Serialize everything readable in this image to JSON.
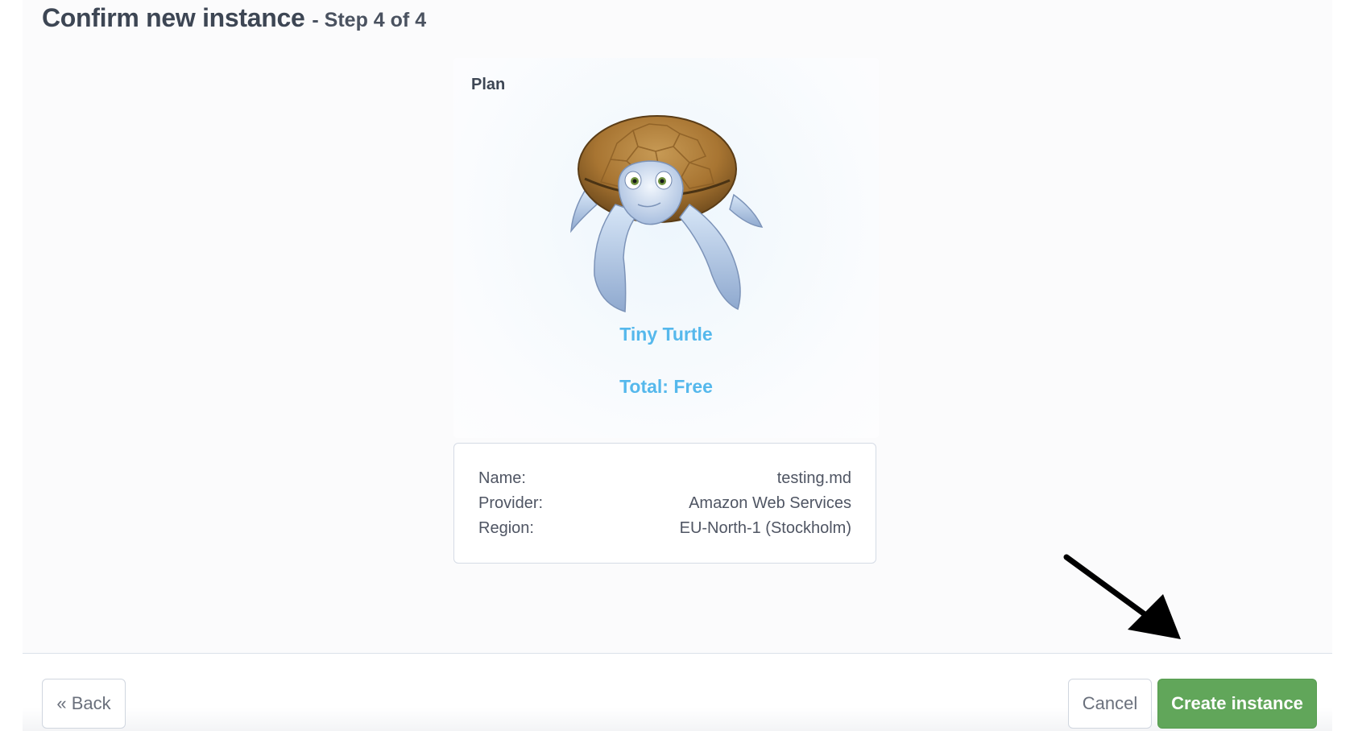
{
  "header": {
    "title": "Confirm new instance",
    "step": "- Step 4 of 4"
  },
  "plan_card": {
    "heading": "Plan",
    "mascot_icon": "turtle-mascot",
    "plan_name": "Tiny Turtle",
    "total": "Total: Free"
  },
  "details": {
    "rows": [
      {
        "label": "Name:",
        "value": "testing.md"
      },
      {
        "label": "Provider:",
        "value": "Amazon Web Services"
      },
      {
        "label": "Region:",
        "value": "EU-North-1 (Stockholm)"
      }
    ]
  },
  "footer": {
    "back_label": "« Back",
    "cancel_label": "Cancel",
    "create_label": "Create instance"
  },
  "annotation": {
    "icon": "arrow-icon",
    "points_to": "Create instance"
  },
  "colors": {
    "accent_blue": "#55b8ec",
    "primary_green": "#61a65a"
  }
}
